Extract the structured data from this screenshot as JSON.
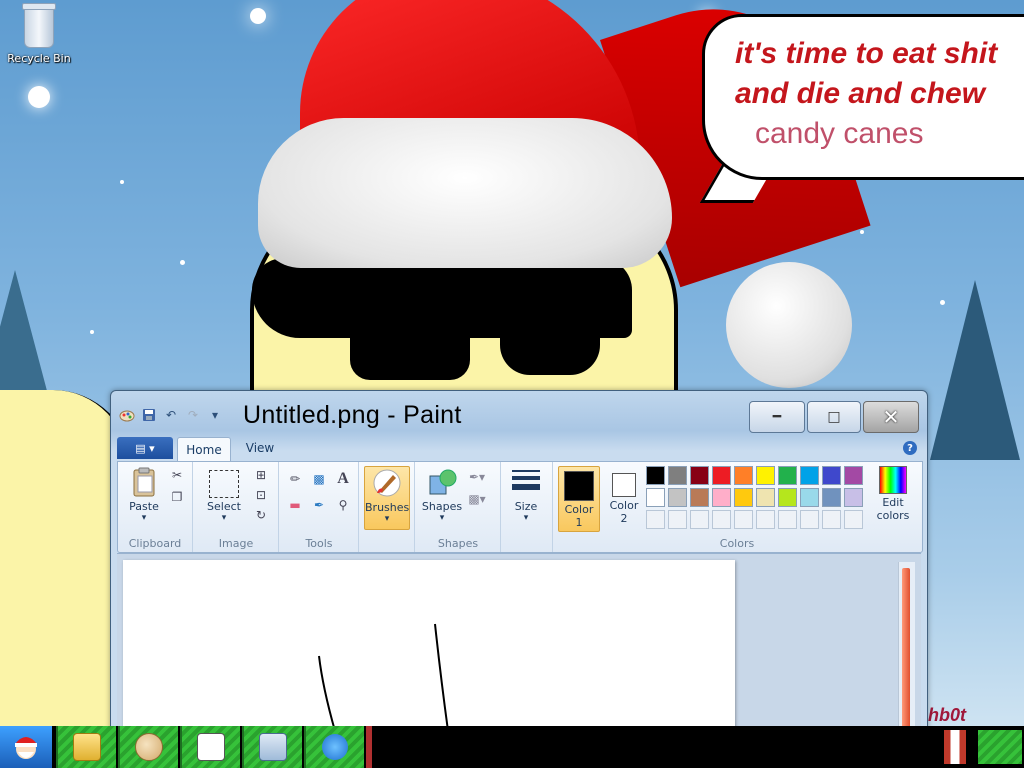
{
  "desktop": {
    "recycle_bin_label": "Recycle Bin"
  },
  "wallpaper": {
    "bubble_line1": "it's time to eat shit",
    "bubble_line2": "and die and chew",
    "bubble_line3": "candy canes",
    "signature": "hb0t"
  },
  "window": {
    "title": "Untitled.png - Paint",
    "min_icon": "minimize-icon",
    "max_icon": "maximize-icon",
    "close_icon": "close-icon"
  },
  "ribbon": {
    "tabs": [
      {
        "label": "Home"
      },
      {
        "label": "View"
      }
    ],
    "clipboard": {
      "paste": "Paste",
      "group": "Clipboard"
    },
    "image": {
      "select": "Select",
      "group": "Image"
    },
    "tools": {
      "group": "Tools"
    },
    "brushes": {
      "label": "Brushes"
    },
    "shapes": {
      "label": "Shapes",
      "group": "Shapes"
    },
    "size": {
      "label": "Size"
    },
    "colors": {
      "color1_label": "Color",
      "color1_num": "1",
      "color2_label": "Color",
      "color2_num": "2",
      "edit_label": "Edit",
      "edit_label2": "colors",
      "group": "Colors",
      "color1_value": "#000000",
      "color2_value": "#ffffff",
      "palette_row1": [
        "#000000",
        "#7f7f7f",
        "#880015",
        "#ed1c24",
        "#ff7f27",
        "#fff200",
        "#22b14c",
        "#00a2e8",
        "#3f48cc",
        "#a349a4"
      ],
      "palette_row2": [
        "#ffffff",
        "#c3c3c3",
        "#b97a57",
        "#ffaec9",
        "#ffc90e",
        "#efe4b0",
        "#b5e61d",
        "#99d9ea",
        "#7092be",
        "#c8bfe7"
      ]
    }
  },
  "taskbar": {
    "items": [
      "explorer-icon",
      "paint-icon",
      "notepad-icon",
      "control-panel-icon",
      "ie-icon"
    ]
  }
}
